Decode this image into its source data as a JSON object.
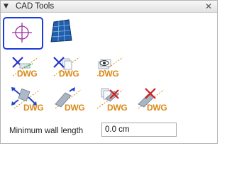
{
  "header": {
    "title": "CAD Tools",
    "arrow": "▼",
    "close": "✕"
  },
  "tools": [
    {
      "name": "crosshair-tool",
      "icon": "crosshair-icon",
      "label": ""
    },
    {
      "name": "solar-panel-tool",
      "icon": "solar-panel-icon",
      "label": ""
    },
    {
      "name": "dwg-export-walls",
      "icon": "dwg-walls-icon",
      "label": "DWG"
    },
    {
      "name": "dwg-export-layers",
      "icon": "dwg-layers-icon",
      "label": "DWG"
    },
    {
      "name": "dwg-export-view",
      "icon": "dwg-eye-icon",
      "label": "DWG"
    },
    {
      "name": "dwg-import-arrows",
      "icon": "dwg-arrows-icon",
      "label": "DWG"
    },
    {
      "name": "dwg-import-diagonal",
      "icon": "dwg-diagonal-icon",
      "label": "DWG"
    },
    {
      "name": "dwg-remove-layers",
      "icon": "dwg-remove-layers-icon",
      "label": "DWG"
    },
    {
      "name": "dwg-remove",
      "icon": "dwg-remove-icon",
      "label": "DWG"
    }
  ],
  "wall": {
    "label": "Minimum wall length",
    "value": "0.0 cm"
  },
  "colors": {
    "selection": "#1a3cdc",
    "dwg_text": "#d98a1a",
    "crosshair": "#9b2fa0"
  }
}
